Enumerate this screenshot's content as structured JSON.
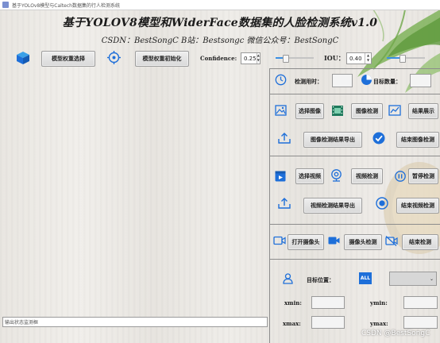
{
  "window": {
    "title": "基于YOLOv8模型与Caltech数据集的行人检测系统"
  },
  "header": {
    "title": "基于YOLOV8模型和WiderFace数据集的人脸检测系统v1.0",
    "subtitle": "CSDN：BestSongC   B站：Bestsongc   微信公众号：BestSongC"
  },
  "toolbar": {
    "select_weights": "模型权重选择",
    "init_weights": "模型权重初始化",
    "confidence_label": "Confidence:",
    "confidence_value": "0.25",
    "confidence_level": 0.25,
    "iou_label": "IOU：",
    "iou_value": "0.40",
    "iou_level": 0.4
  },
  "stats": {
    "time_label": "检测用时：",
    "count_label": "目标数量："
  },
  "image": {
    "select": "选择图像",
    "detect": "图像检测",
    "show": "结果展示",
    "export": "图像检测结果导出",
    "stop": "结束图像检测"
  },
  "video": {
    "select": "选择视频",
    "detect": "视频检测",
    "pause": "暂停检测",
    "export": "视频检测结果导出",
    "stop": "结束视频检测"
  },
  "camera": {
    "open": "打开摄像头",
    "detect": "摄像头检测",
    "stop": "结束检测"
  },
  "target": {
    "position_label": "目标位置：",
    "all_icon_text": "ALL",
    "xmin": "xmin:",
    "ymin": "ymin:",
    "xmax": "xmax:",
    "ymax": "ymax:"
  },
  "status": {
    "text": "输出状态监测框"
  },
  "watermark": "CSDN @BestSongC",
  "icons": [
    "cube-icon",
    "target-icon",
    "clock-icon",
    "pie-icon",
    "image-icon",
    "film-icon",
    "chart-icon",
    "upload-icon",
    "check-icon",
    "video-icon",
    "webcam-icon",
    "pause-icon",
    "stop-icon",
    "camera-icon",
    "person-icon",
    "all-icon"
  ],
  "colors": {
    "accent": "#1e6fd9",
    "slider_fill": "#3b8fe2",
    "input_bg": "#f4f4f4"
  }
}
